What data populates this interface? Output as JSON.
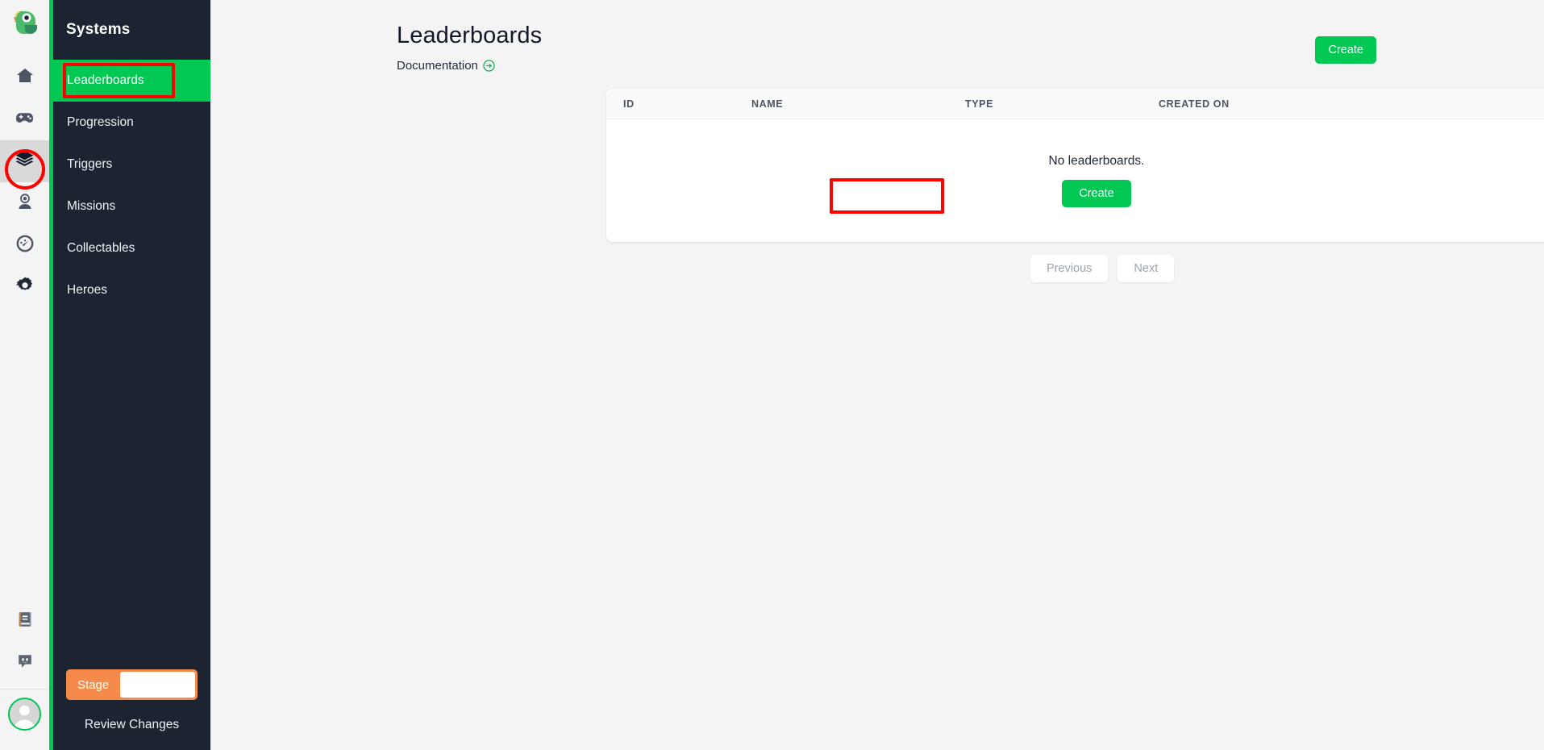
{
  "rail": {
    "logo": {
      "name": "parrot-logo"
    },
    "items": [
      {
        "id": "home",
        "icon": "home-icon",
        "active": false
      },
      {
        "id": "games",
        "icon": "gamepad-icon",
        "active": false
      },
      {
        "id": "systems",
        "icon": "layers-icon",
        "active": true
      },
      {
        "id": "players",
        "icon": "user-circle-icon",
        "active": false
      },
      {
        "id": "analytics",
        "icon": "gauge-icon",
        "active": false
      },
      {
        "id": "settings",
        "icon": "gear-icon",
        "active": false
      }
    ],
    "bottom_items": [
      {
        "id": "docs",
        "icon": "book-icon"
      },
      {
        "id": "discord",
        "icon": "discord-icon"
      }
    ],
    "avatar": {
      "name": "user-avatar"
    }
  },
  "sidebar": {
    "title": "Systems",
    "items": [
      {
        "label": "Leaderboards",
        "active": true
      },
      {
        "label": "Progression",
        "active": false
      },
      {
        "label": "Triggers",
        "active": false
      },
      {
        "label": "Missions",
        "active": false
      },
      {
        "label": "Collectables",
        "active": false
      },
      {
        "label": "Heroes",
        "active": false
      }
    ],
    "stage": {
      "label": "Stage",
      "value": ""
    },
    "review_changes": "Review Changes"
  },
  "main": {
    "title": "Leaderboards",
    "documentation_label": "Documentation",
    "create_button": "Create",
    "table": {
      "columns": [
        "ID",
        "NAME",
        "TYPE",
        "CREATED ON"
      ],
      "rows": [],
      "empty_text": "No leaderboards.",
      "empty_create_button": "Create"
    },
    "pagination": {
      "previous": "Previous",
      "next": "Next"
    }
  },
  "colors": {
    "accent_green": "#00c853",
    "sidebar_bg": "#1b2430",
    "stage_orange": "#f58a4b",
    "annotation_red": "#ff0000",
    "page_bg": "#f4f4f5"
  }
}
